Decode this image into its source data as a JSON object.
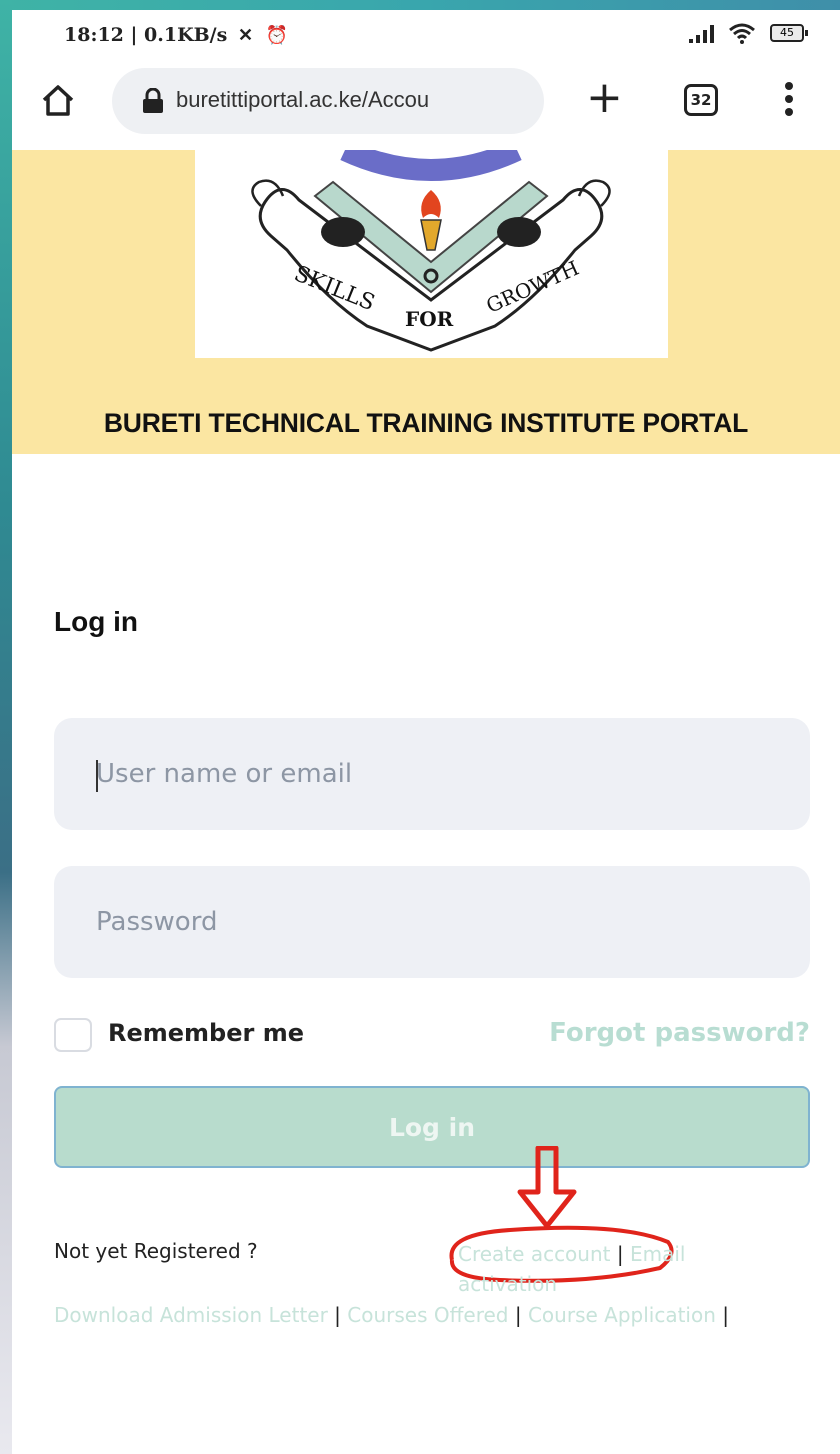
{
  "status_bar": {
    "time_speed": "18:12 | 0.1KB/s",
    "battery": "45"
  },
  "browser": {
    "url": "buretittiportal.ac.ke/Accou",
    "tab_count": "32"
  },
  "header": {
    "logo_motto": [
      "SKILLS",
      "FOR",
      "GROWTH"
    ],
    "title": "BURETI TECHNICAL TRAINING INSTITUTE PORTAL"
  },
  "login": {
    "heading": "Log in",
    "username_placeholder": "User name or email",
    "password_placeholder": "Password",
    "remember_label": "Remember me",
    "forgot_label": "Forgot password?",
    "button_label": "Log in"
  },
  "footer": {
    "not_registered": "Not yet Registered ?",
    "create_account": "Create account",
    "email_activation": "Email activation",
    "separator": "|",
    "download_admission": "Download Admission Letter",
    "courses_offered": "Courses Offered",
    "course_application": "Course Application"
  },
  "colors": {
    "banner": "#fbe6a2",
    "accent": "#b8dccd",
    "annotation": "#e0241b"
  }
}
